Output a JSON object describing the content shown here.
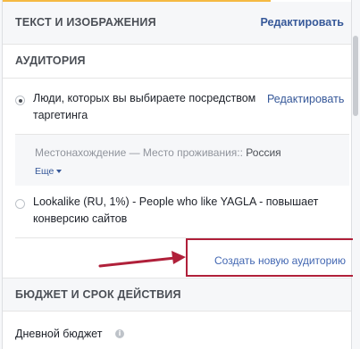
{
  "text_section": {
    "title": "ТЕКСТ И ИЗОБРАЖЕНИЯ",
    "edit_label": "Редактировать"
  },
  "audience_section": {
    "title": "АУДИТОРИЯ",
    "options": [
      {
        "label": "Люди, которых вы выбираете посредством",
        "label_line2": "таргетинга",
        "edit_label": "Редактировать",
        "selected": true
      },
      {
        "label": "Lookalike (RU, 1%) - People who like YAGLA - повышает",
        "label_line2": "конверсию сайтов",
        "selected": false
      }
    ],
    "location": {
      "label": "Местонахождение — Место проживания::",
      "value": "Россия",
      "more_label": "Еще"
    },
    "create_new_label": "Создать новую аудиторию"
  },
  "budget_section": {
    "title": "БЮДЖЕТ И СРОК ДЕЙСТВИЯ",
    "daily_budget_label": "Дневной бюджет",
    "info_icon": "info-icon"
  },
  "colors": {
    "link": "#365899",
    "highlight": "#b0203a",
    "section_bg": "#f6f7f9",
    "accent_top": "#f5b942"
  }
}
